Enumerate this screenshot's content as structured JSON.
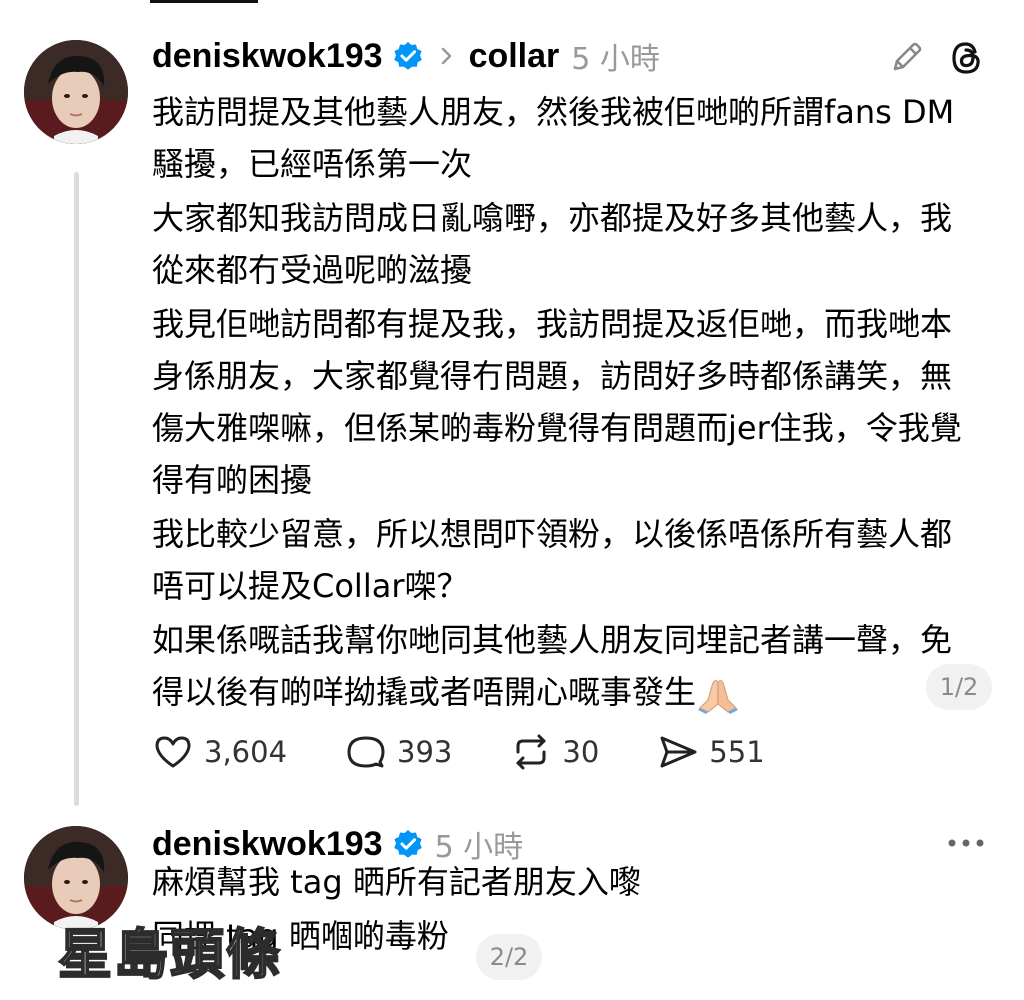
{
  "posts": [
    {
      "username": "deniskwok193",
      "community": "collar",
      "time": "5 小時",
      "paragraphs": [
        "我訪問提及其他藝人朋友，然後我被佢哋啲所謂fans DM騷擾，已經唔係第一次",
        "大家都知我訪問成日亂噏嘢，亦都提及好多其他藝人，我從來都冇受過呢啲滋擾",
        "我見佢哋訪問都有提及我，我訪問提及返佢哋，而我哋本身係朋友，大家都覺得冇問題，訪問好多時都係講笑，無傷大雅㗎嘛，但係某啲毒粉覺得有問題而jer住我，令我覺得有啲困擾",
        "我比較少留意，所以想問吓領粉，以後係唔係所有藝人都唔可以提及Collar㗎？",
        "如果係嘅話我幫你哋同其他藝人朋友同埋記者講一聲，免得以後有啲咩拗撬或者唔開心嘅事發生"
      ],
      "page_indicator": "1/2",
      "stats": {
        "likes": "3,604",
        "comments": "393",
        "reposts": "30",
        "shares": "551"
      }
    },
    {
      "username": "deniskwok193",
      "time": "5 小時",
      "paragraphs": [
        "麻煩幫我 tag 晒所有記者朋友入嚟",
        "同埋 tag 晒嗰啲毒粉"
      ],
      "page_indicator": "2/2"
    }
  ],
  "icons": {
    "verified": "verified-badge-icon",
    "chevron": "chevron-right-icon",
    "edit": "pencil-icon",
    "threads": "threads-logo-icon",
    "emoji": "folded-hands-emoji",
    "like": "heart-icon",
    "comment": "comment-bubble-icon",
    "repost": "repost-icon",
    "share": "send-icon",
    "more": "more-dots-icon"
  },
  "watermark": "星島頭條",
  "colors": {
    "verified": "#0095f6",
    "secondary_text": "#999999",
    "thread_line": "#dcdcdc"
  }
}
